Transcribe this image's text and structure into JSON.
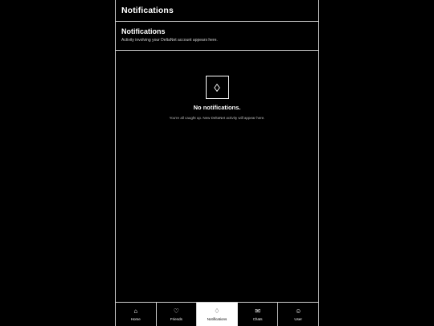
{
  "topbar": {
    "title": "Notifications"
  },
  "section": {
    "title": "Notifications",
    "subtitle": "Activity involving your DeltaNet account appears here."
  },
  "empty": {
    "icon": "diamond-icon",
    "title": "No notifications.",
    "subtitle": "You're all caught up. New DeltaNet activity will appear here."
  },
  "nav": {
    "active": "Notifications",
    "items": [
      {
        "label": "Home",
        "icon": "home-icon",
        "glyph": "⌂"
      },
      {
        "label": "Friends",
        "icon": "heart-icon",
        "glyph": "♡"
      },
      {
        "label": "Notifications",
        "icon": "diamond-icon",
        "glyph": "♢"
      },
      {
        "label": "Chats",
        "icon": "envelope-icon",
        "glyph": "✉"
      },
      {
        "label": "User",
        "icon": "user-icon",
        "glyph": "☺"
      }
    ]
  }
}
